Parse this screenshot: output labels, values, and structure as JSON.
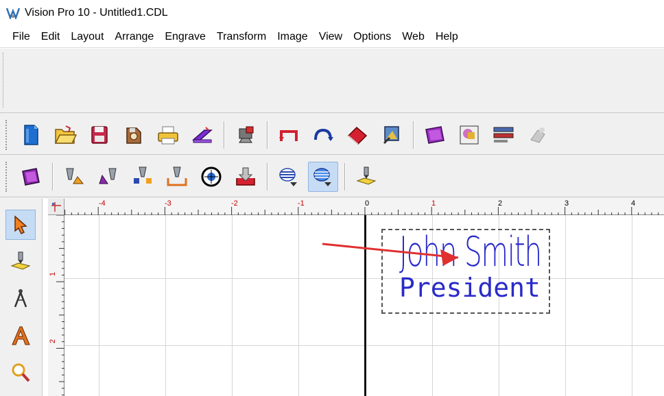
{
  "window": {
    "title": "Vision Pro 10 - Untitled1.CDL"
  },
  "menu": [
    "File",
    "Edit",
    "Layout",
    "Arrange",
    "Engrave",
    "Transform",
    "Image",
    "View",
    "Options",
    "Web",
    "Help"
  ],
  "toolbar1": {
    "buttons": [
      "new-file-icon",
      "open-folder-icon",
      "save-disk-icon",
      "save-all-icon",
      "print-icon",
      "engrave-send-icon",
      "machine-setup-icon",
      "undo-icon",
      "redo-icon",
      "erase-icon",
      "zoom-preview-icon",
      "layer-icon",
      "image-properties-icon",
      "text-properties-icon",
      "disabled-tool-icon"
    ]
  },
  "toolbar2": {
    "buttons": [
      "plate-icon",
      "cutter-a-icon",
      "cutter-b-icon",
      "cutter-c-icon",
      "cutter-d-icon",
      "target-icon",
      "download-icon",
      "fill-lines-icon",
      "fill-lines-active-icon",
      "engraver-icon"
    ],
    "pressed": "fill-lines-active-icon"
  },
  "left_tools": [
    "select-arrow-icon",
    "engraver-tool-icon",
    "compass-icon",
    "text-tool-icon",
    "zoom-tool-icon"
  ],
  "ruler": {
    "top_labels": [
      "-4",
      "-3",
      "-2",
      "-1",
      "0",
      "1",
      "2",
      "3",
      "4"
    ],
    "left_labels": [
      "1",
      "2"
    ]
  },
  "canvas": {
    "name_text": "John Smith",
    "title_text": "President",
    "text_color": "#2a2ac8",
    "arrow_color": "#e03030"
  }
}
